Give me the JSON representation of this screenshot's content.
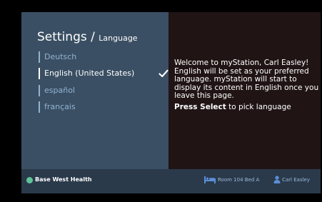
{
  "settings": {
    "title": "Settings",
    "separator": " / ",
    "subtitle": "Language"
  },
  "languages": [
    {
      "label": "Deutsch",
      "selected": false
    },
    {
      "label": "English (United States)",
      "selected": true
    },
    {
      "label": "español",
      "selected": false
    },
    {
      "label": "français",
      "selected": false
    }
  ],
  "message": {
    "body": "Welcome to myStation, Carl Easley! English will be set as your preferred language. myStation will start to display its content in English once you leave this page.",
    "cta_bold": "Press Select",
    "cta_rest": " to pick language"
  },
  "footer": {
    "brand": "Base West Health",
    "room": "Room 104 Bed A",
    "user": "Carl Easley"
  },
  "icons": {
    "selected_indicator": "check-icon",
    "room": "bed-icon",
    "user": "user-icon",
    "brand": "brand-dot-icon"
  },
  "colors": {
    "panel_left": "#3a4f63",
    "panel_right": "#201415",
    "footer": "#2a3a4b",
    "dim_text": "#93b3d3",
    "brand_accent": "#5fc49a",
    "footer_text": "#9ab9d8"
  }
}
